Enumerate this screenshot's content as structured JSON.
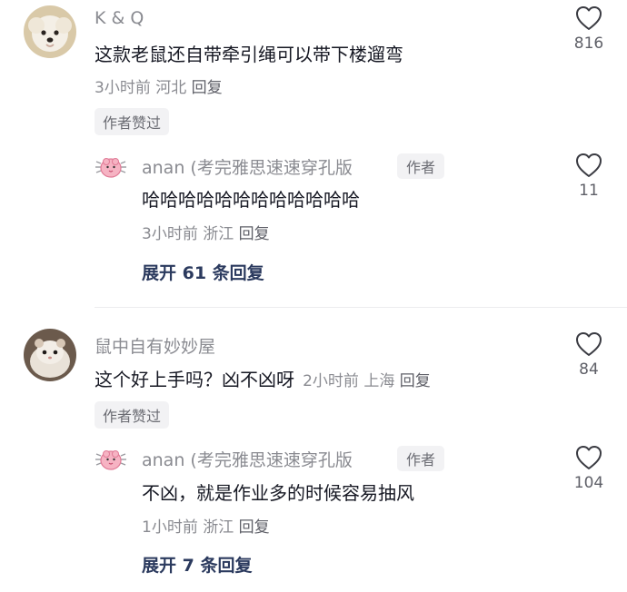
{
  "comments": [
    {
      "username": "K & Q",
      "text": "这款老鼠还自带牵引绳可以带下楼遛弯",
      "time": "3小时前",
      "location": "河北",
      "reply_label": "回复",
      "badge": "作者赞过",
      "likes": "816",
      "reply": {
        "username": "anan (考完雅思速速穿孔版",
        "author_tag": "作者",
        "text": "哈哈哈哈哈哈哈哈哈哈哈哈",
        "time": "3小时前",
        "location": "浙江",
        "reply_label": "回复",
        "likes": "11"
      },
      "expand_label": "展开 61 条回复"
    },
    {
      "username": "鼠中自有妙妙屋",
      "text": "这个好上手吗？凶不凶呀",
      "time": "2小时前",
      "location": "上海",
      "reply_label": "回复",
      "badge": "作者赞过",
      "likes": "84",
      "reply": {
        "username": "anan (考完雅思速速穿孔版",
        "author_tag": "作者",
        "text": "不凶，就是作业多的时候容易抽风",
        "time": "1小时前",
        "location": "浙江",
        "reply_label": "回复",
        "likes": "104"
      },
      "expand_label": "展开 7 条回复"
    }
  ]
}
